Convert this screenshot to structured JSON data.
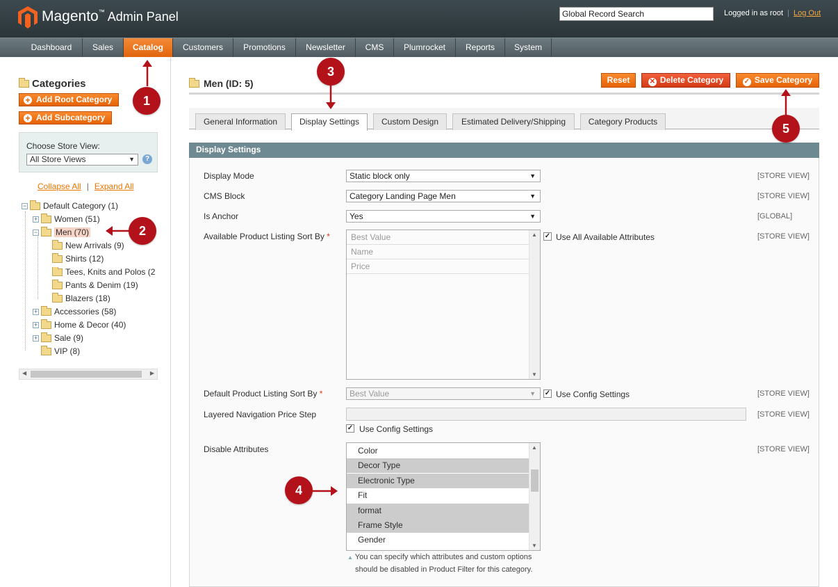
{
  "header": {
    "logo_brand": "Magento",
    "logo_tm": "™",
    "logo_suffix": "Admin Panel",
    "search_value": "Global Record Search",
    "logged_in": "Logged in as root",
    "separator": "|",
    "logout": "Log Out"
  },
  "nav": {
    "items": [
      "Dashboard",
      "Sales",
      "Catalog",
      "Customers",
      "Promotions",
      "Newsletter",
      "CMS",
      "Plumrocket",
      "Reports",
      "System"
    ],
    "active": "Catalog"
  },
  "sidebar": {
    "title": "Categories",
    "add_root": "Add Root Category",
    "add_sub": "Add Subcategory",
    "store_label": "Choose Store View:",
    "store_value": "All Store Views",
    "help": "?",
    "collapse": "Collapse All",
    "link_sep": "|",
    "expand": "Expand All",
    "tree": {
      "root": "Default Category (1)",
      "women": "Women (51)",
      "men": "Men (70)",
      "new_arrivals": "New Arrivals (9)",
      "shirts": "Shirts (12)",
      "tees": "Tees, Knits and Polos (2",
      "pants": "Pants & Denim (19)",
      "blazers": "Blazers (18)",
      "accessories": "Accessories (58)",
      "home_decor": "Home & Decor (40)",
      "sale": "Sale (9)",
      "vip": "VIP (8)"
    }
  },
  "main": {
    "title": "Men (ID: 5)",
    "reset": "Reset",
    "delete": "Delete Category",
    "save": "Save Category",
    "tabs": [
      "General Information",
      "Display Settings",
      "Custom Design",
      "Estimated Delivery/Shipping",
      "Category Products"
    ],
    "active_tab": "Display Settings",
    "section": "Display Settings",
    "fields": {
      "display_mode_label": "Display Mode",
      "display_mode_value": "Static block only",
      "display_mode_scope": "[STORE VIEW]",
      "cms_label": "CMS Block",
      "cms_value": "Category Landing Page Men",
      "cms_scope": "[STORE VIEW]",
      "anchor_label": "Is Anchor",
      "anchor_value": "Yes",
      "anchor_scope": "[GLOBAL]",
      "sortby_label": "Available Product Listing Sort By",
      "req": "*",
      "sortby_options": [
        "Best Value",
        "Name",
        "Price"
      ],
      "sortby_check": "Use All Available Attributes",
      "sortby_scope": "[STORE VIEW]",
      "default_sort_label": "Default Product Listing Sort By",
      "default_sort_value": "Best Value",
      "default_sort_check": "Use Config Settings",
      "default_sort_scope": "[STORE VIEW]",
      "price_step_label": "Layered Navigation Price Step",
      "price_step_check": "Use Config Settings",
      "price_step_scope": "[STORE VIEW]",
      "disable_label": "Disable Attributes",
      "disable_options": [
        "Color",
        "Decor Type",
        "Electronic Type",
        "Fit",
        "format",
        "Frame Style",
        "Gender"
      ],
      "disable_selected": [
        false,
        true,
        true,
        false,
        true,
        true,
        false
      ],
      "disable_scope": "[STORE VIEW]",
      "note_line1": "You can specify which attributes and custom options",
      "note_line2": "should be disabled in Product Filter for this category."
    }
  },
  "markers": [
    "1",
    "2",
    "3",
    "4",
    "5"
  ],
  "colors": {
    "accent": "#e56306",
    "marker": "#b3121a",
    "section": "#6f8992"
  }
}
